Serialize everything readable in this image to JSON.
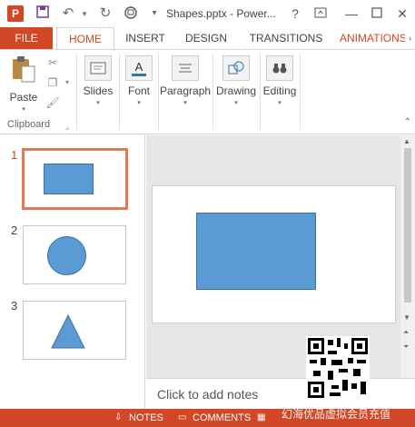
{
  "titlebar": {
    "app_icon": "P",
    "title": "Shapes.pptx - Power...",
    "help": "?",
    "icons": [
      "save-icon",
      "undo-icon",
      "redo-icon",
      "start-from-beginning-icon",
      "customize-qat-icon"
    ]
  },
  "tabs": [
    {
      "label": "FILE"
    },
    {
      "label": "HOME"
    },
    {
      "label": "INSERT"
    },
    {
      "label": "DESIGN"
    },
    {
      "label": "TRANSITIONS"
    },
    {
      "label": "ANIMATIONS"
    }
  ],
  "ribbon": {
    "clipboard": {
      "paste": "Paste",
      "group_label": "Clipboard"
    },
    "slides": "Slides",
    "font": "Font",
    "paragraph": "Paragraph",
    "drawing": "Drawing",
    "editing": "Editing"
  },
  "thumbnails": [
    {
      "number": "1",
      "shape": "rectangle"
    },
    {
      "number": "2",
      "shape": "circle"
    },
    {
      "number": "3",
      "shape": "triangle"
    }
  ],
  "notes": {
    "placeholder": "Click to add notes"
  },
  "statusbar": {
    "notes": "NOTES",
    "comments": "COMMENTS"
  },
  "watermark": "幻海优品虚拟会员充值",
  "colors": {
    "accent": "#d24726",
    "shape_fill": "#5b9bd5",
    "shape_border": "#41719c"
  }
}
